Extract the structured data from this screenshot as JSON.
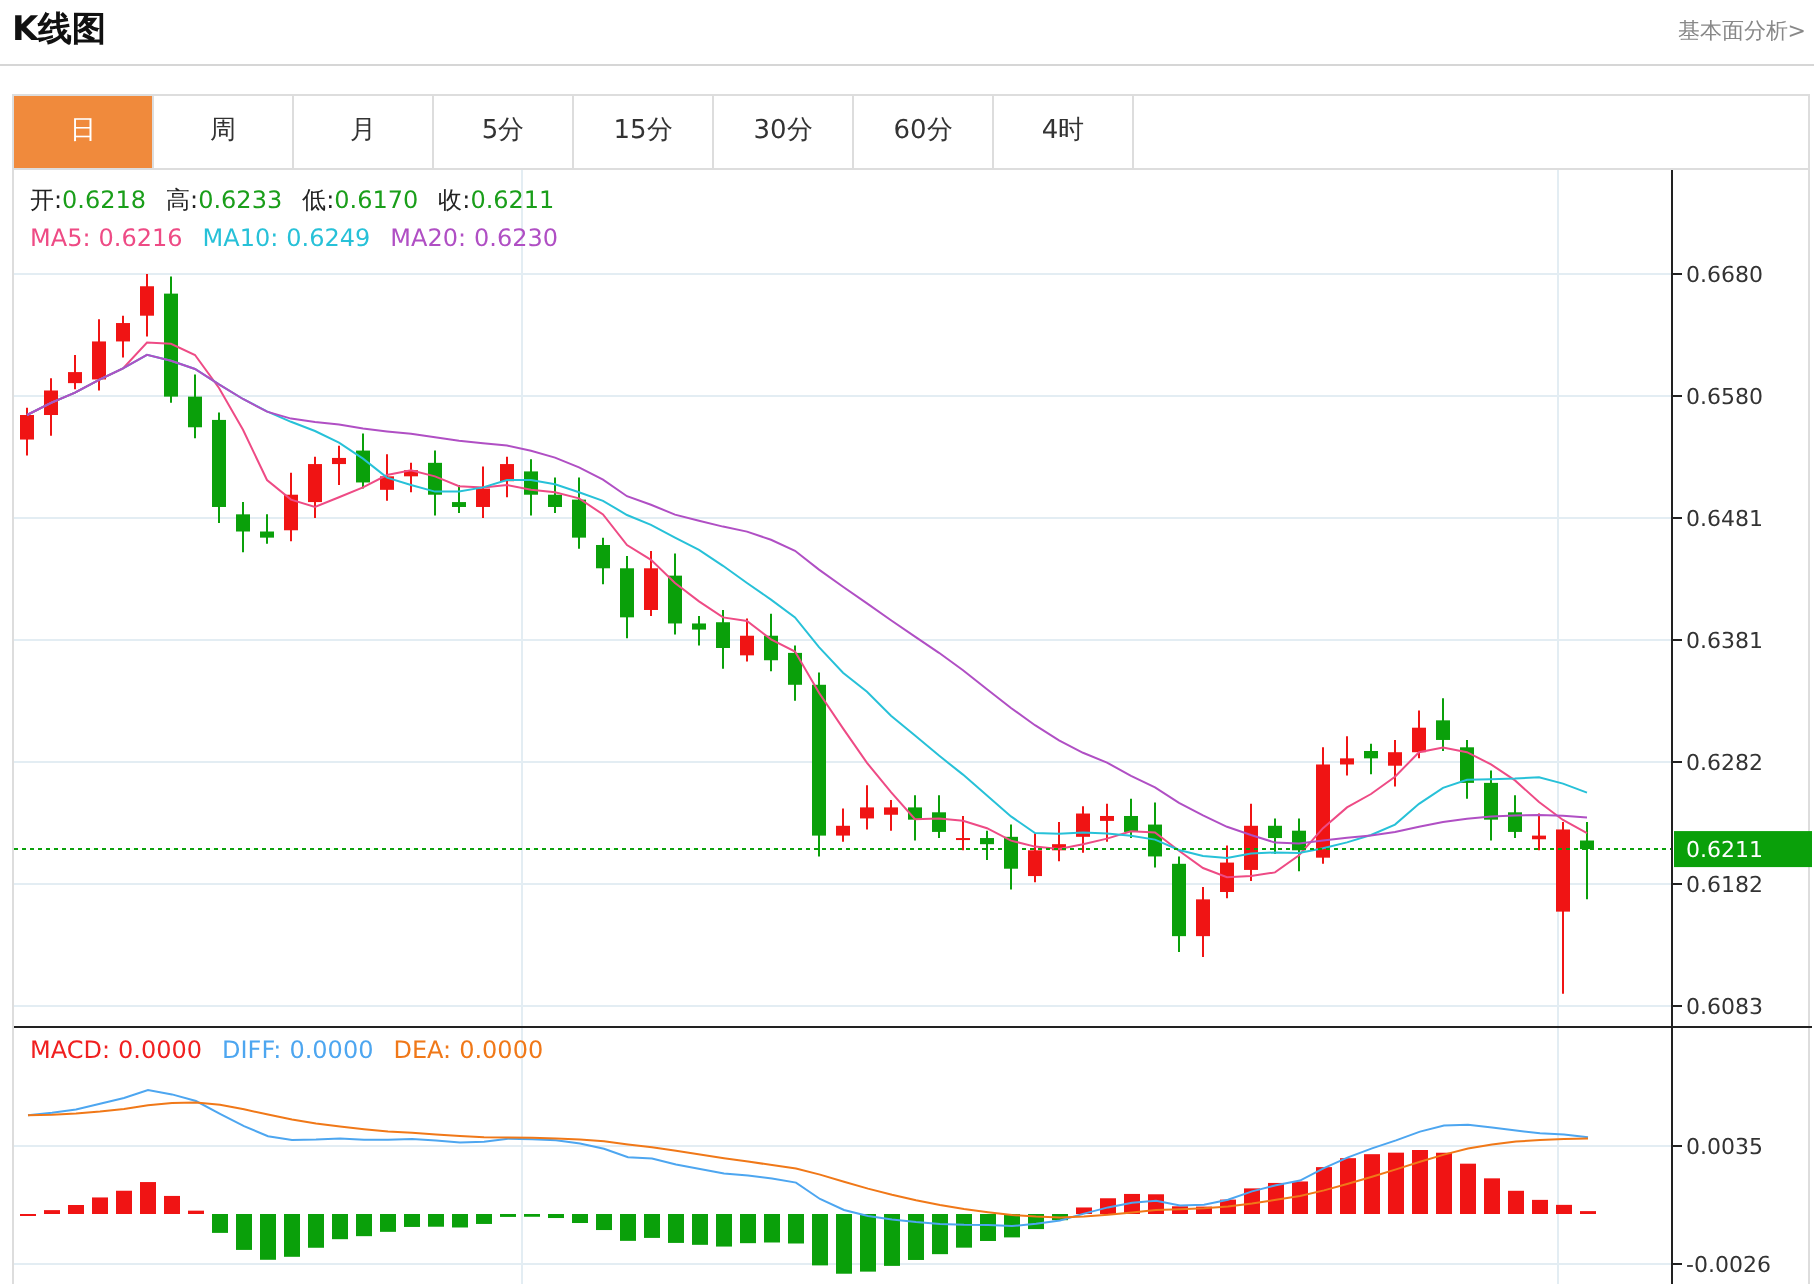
{
  "header": {
    "title": "K线图",
    "link": "基本面分析>"
  },
  "tabs": [
    {
      "label": "日",
      "selected": true
    },
    {
      "label": "周",
      "selected": false
    },
    {
      "label": "月",
      "selected": false
    },
    {
      "label": "5分",
      "selected": false
    },
    {
      "label": "15分",
      "selected": false
    },
    {
      "label": "30分",
      "selected": false
    },
    {
      "label": "60分",
      "selected": false
    },
    {
      "label": "4时",
      "selected": false
    }
  ],
  "price_legend": [
    {
      "label": "开:",
      "value": "0.6218"
    },
    {
      "label": "高:",
      "value": "0.6233"
    },
    {
      "label": "低:",
      "value": "0.6170"
    },
    {
      "label": "收:",
      "value": "0.6211"
    }
  ],
  "ma_legend": [
    {
      "label": "MA5:",
      "value": "0.6216",
      "color": "#ee4b85"
    },
    {
      "label": "MA10:",
      "value": "0.6249",
      "color": "#27c1d8"
    },
    {
      "label": "MA20:",
      "value": "0.6230",
      "color": "#b04fc4"
    }
  ],
  "price_axis": [
    "0.6680",
    "0.6580",
    "0.6481",
    "0.6381",
    "0.6282",
    "0.6182",
    "0.6083"
  ],
  "current_price": "0.6211",
  "macd_legend": [
    {
      "label": "MACD:",
      "value": "0.0000",
      "color": "#f02020"
    },
    {
      "label": "DIFF:",
      "value": "0.0000",
      "color": "#4da6f0"
    },
    {
      "label": "DEA:",
      "value": "0.0000",
      "color": "#f07818"
    }
  ],
  "macd_axis": [
    "0.0035",
    "-0.0026"
  ]
}
